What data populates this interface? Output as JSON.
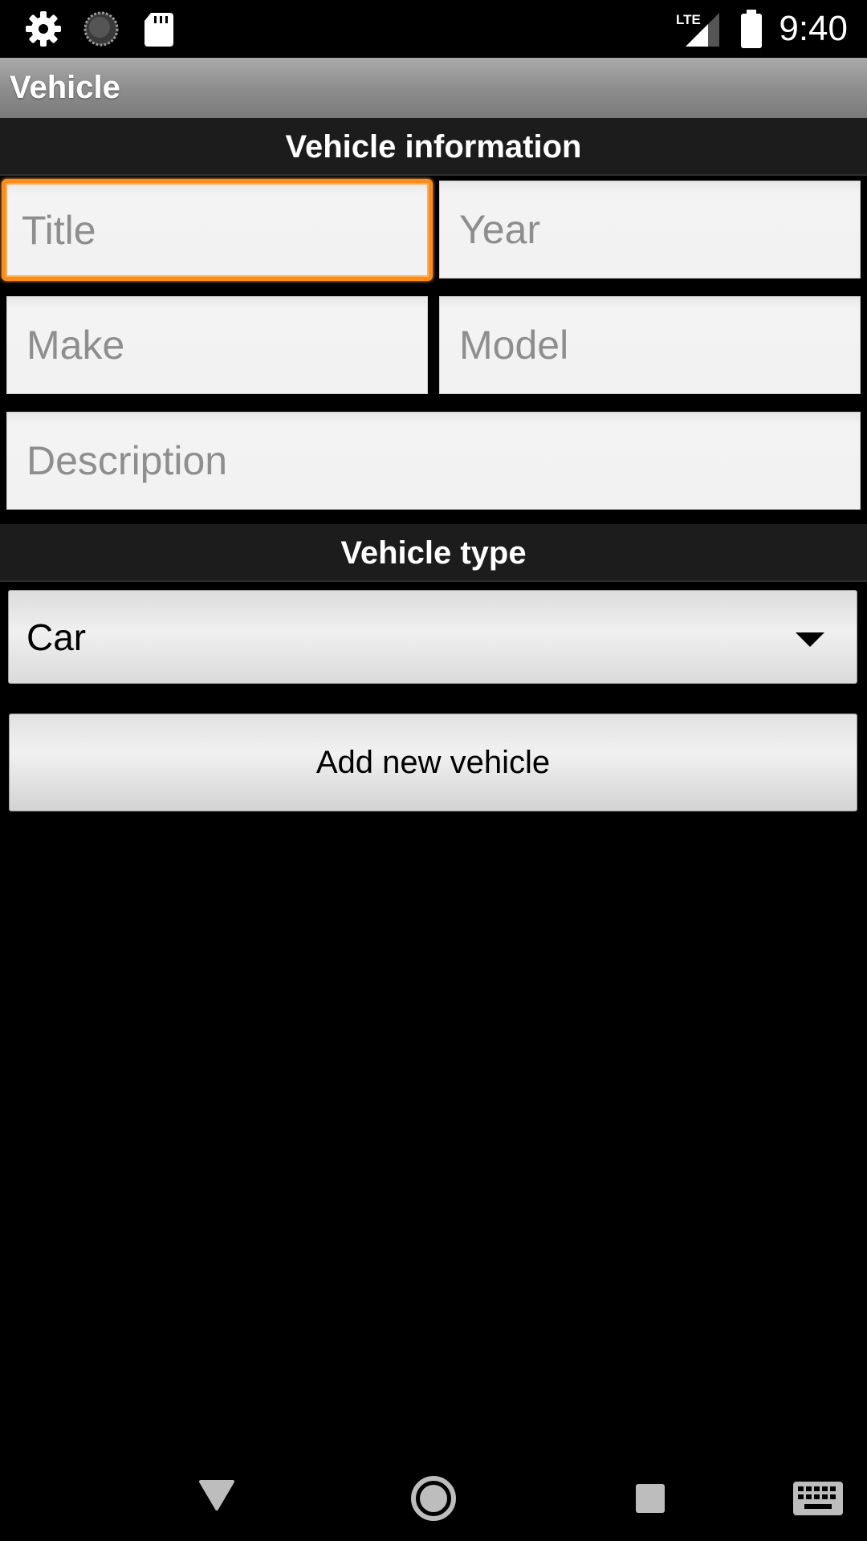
{
  "status_bar": {
    "time": "9:40",
    "network": "LTE",
    "icons": [
      "gear-icon",
      "sync-icon",
      "sd-card-icon",
      "lte-signal-icon",
      "battery-icon"
    ]
  },
  "action_bar": {
    "title": "Vehicle"
  },
  "vehicle_info": {
    "header": "Vehicle information",
    "title_placeholder": "Title",
    "year_placeholder": "Year",
    "make_placeholder": "Make",
    "model_placeholder": "Model",
    "description_placeholder": "Description"
  },
  "vehicle_type": {
    "header": "Vehicle type",
    "selected": "Car"
  },
  "add_button": {
    "label": "Add new vehicle"
  },
  "nav_bar": {
    "icons": [
      "back-icon",
      "home-icon",
      "recents-icon",
      "keyboard-icon"
    ]
  },
  "colors": {
    "focus_accent": "#ff8c1a",
    "action_bar": "#8c8c8c",
    "background": "#000000"
  }
}
